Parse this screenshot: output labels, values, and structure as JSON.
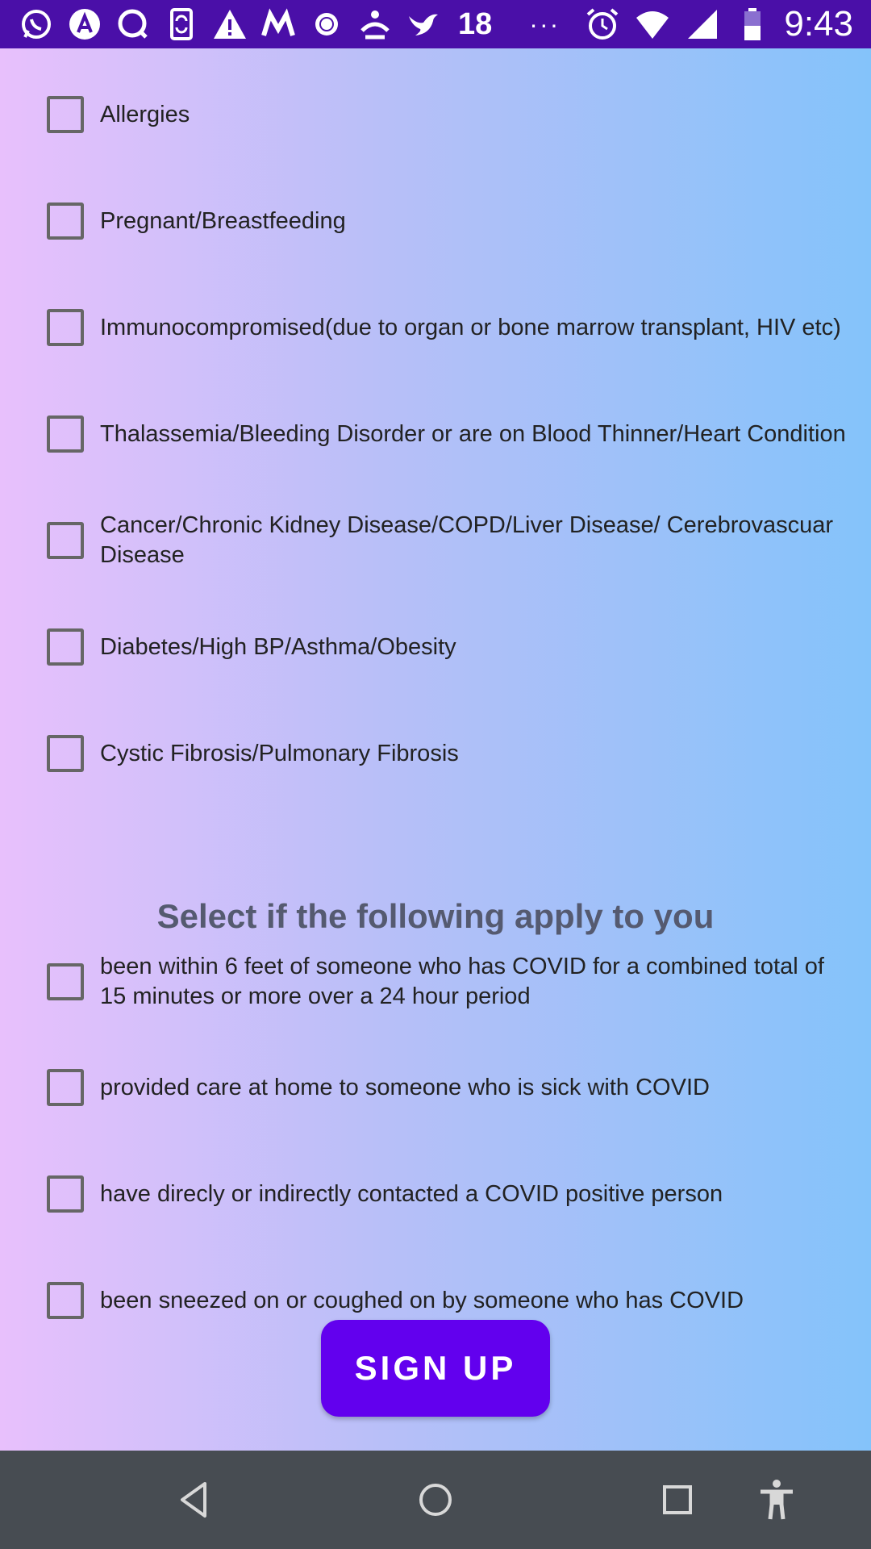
{
  "status_bar": {
    "notification_icons": [
      "whatsapp-icon",
      "app-a-icon",
      "chat-icon",
      "phone-sync-icon",
      "alert-icon",
      "m-app-icon",
      "brightness-icon",
      "person-transfer-icon",
      "bird-icon"
    ],
    "notification_count": "18",
    "more": "···",
    "time": "9:43"
  },
  "conditions": [
    {
      "label": "Allergies",
      "checked": false
    },
    {
      "label": "Pregnant/Breastfeeding",
      "checked": false
    },
    {
      "label": "Immunocompromised(due to organ or bone marrow transplant, HIV etc)",
      "checked": false
    },
    {
      "label": "Thalassemia/Bleeding Disorder or are on Blood Thinner/Heart Condition",
      "checked": false
    },
    {
      "label": "Cancer/Chronic Kidney Disease/COPD/Liver Disease/ Cerebrovascuar Disease",
      "checked": false
    },
    {
      "label": "Diabetes/High BP/Asthma/Obesity",
      "checked": false
    },
    {
      "label": "Cystic Fibrosis/Pulmonary Fibrosis",
      "checked": false
    }
  ],
  "exposure_section": {
    "title": "Select if the following apply to you",
    "items": [
      {
        "label": "been within 6 feet of someone who has COVID for a combined total of 15 minutes or more over a 24 hour period",
        "checked": false
      },
      {
        "label": "provided care at home to someone who is sick with COVID",
        "checked": false
      },
      {
        "label": "have direcly or indirectly contacted a COVID positive person",
        "checked": false
      },
      {
        "label": "been sneezed on or coughed on by someone who has COVID",
        "checked": false
      }
    ]
  },
  "signup_button": {
    "label": "SIGN UP"
  },
  "colors": {
    "accent": "#6200ee",
    "status_bar": "#4a0fa8",
    "nav_bar": "#474c52"
  },
  "nav_bar": {
    "buttons": [
      "back-icon",
      "home-icon",
      "recents-icon",
      "accessibility-icon"
    ]
  }
}
